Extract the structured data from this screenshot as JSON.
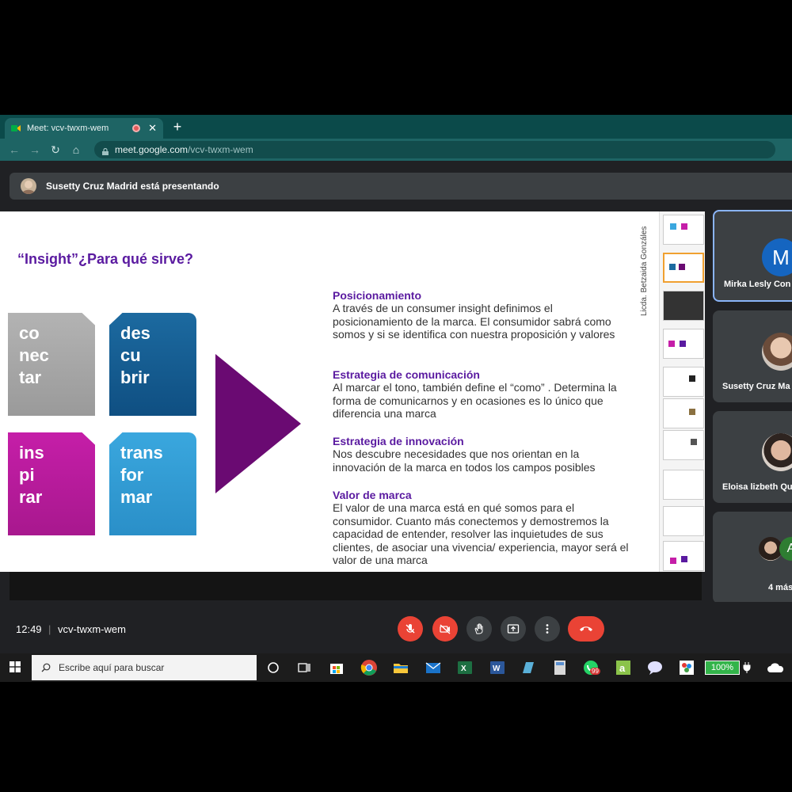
{
  "browser": {
    "tab_title": "Meet: vcv-twxm-wem",
    "new_tab": "+",
    "url_host": "meet.google.com",
    "url_path": "/vcv-twxm-wem"
  },
  "meet": {
    "presenting_text": "Susetty Cruz Madrid está presentando",
    "time": "12:49",
    "separator": "|",
    "meeting_code": "vcv-twxm-wem",
    "participants": [
      {
        "name": "Mirka Lesly Con",
        "initial": "M"
      },
      {
        "name": "Susetty Cruz Ma"
      },
      {
        "name": "Eloisa lizbeth Qu"
      },
      {
        "name": "4 más",
        "initial": "A"
      }
    ]
  },
  "slide": {
    "title": "“Insight”¿Para qué sirve?",
    "tiles": {
      "gray": [
        "co",
        "nec",
        "tar"
      ],
      "navy": [
        "des",
        "cu",
        "brir"
      ],
      "magenta": [
        "ins",
        "pi",
        "rar"
      ],
      "blue": [
        "trans",
        "for",
        "mar"
      ]
    },
    "items": [
      {
        "heading": "Posicionamiento",
        "text": "A través de un consumer insight definimos el posicionamiento de la marca. El consumidor sabrá como somos y si se identifica con nuestra proposición y valores"
      },
      {
        "heading": "Estrategia de comunicación",
        "text": "Al marcar el tono, también define el “como” . Determina la forma de comunicarnos y en ocasiones es lo único que diferencia una marca"
      },
      {
        "heading": "Estrategia de innovación",
        "text": "Nos descubre necesidades que nos orientan en la innovación de la marca en todos los campos posibles"
      },
      {
        "heading": "Valor de marca",
        "text": "El valor de una marca está en qué somos para el consumidor. Cuanto más conectemos y demostremos la capacidad de entender, resolver las inquietudes de sus clientes, de asociar una vivencia/ experiencia, mayor será el valor de una marca"
      }
    ],
    "vertical_label": "Licda. Betzaida Gonzáles"
  },
  "taskbar": {
    "search_placeholder": "Escribe aquí para buscar",
    "battery": "100%",
    "whatsapp_badge": "99"
  },
  "colors": {
    "chrome_dark": "#0b4a4a",
    "chrome_bar": "#1e6464",
    "meet_bg": "#202124",
    "hangup_red": "#ea4335",
    "slide_purple": "#5a1aa0"
  }
}
